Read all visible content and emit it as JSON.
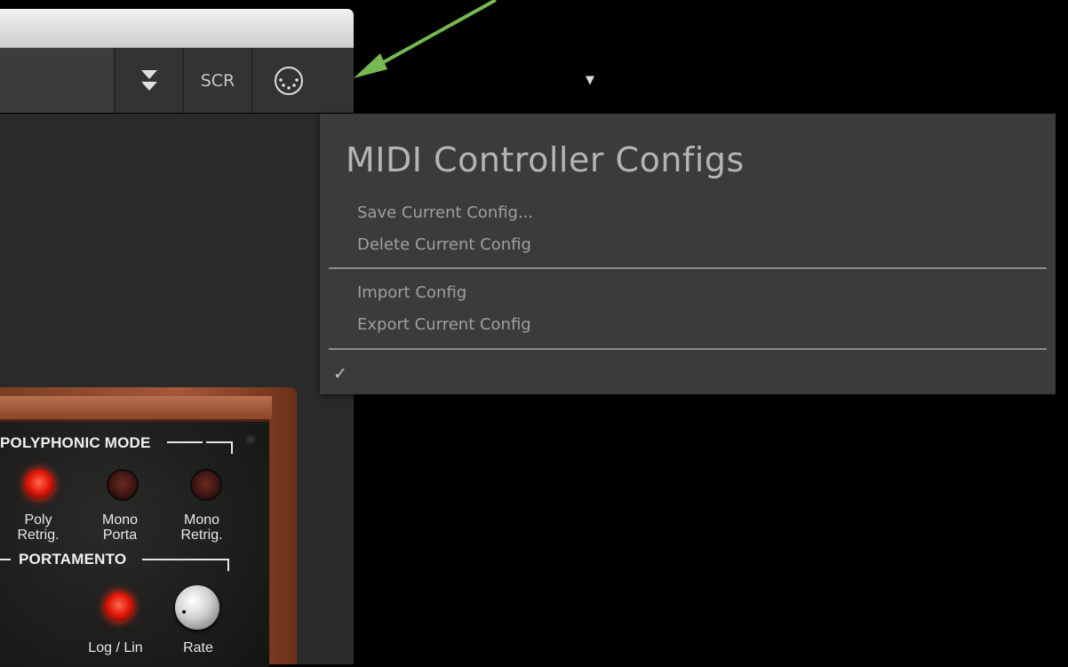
{
  "toolbar": {
    "scr_label": "SCR",
    "collapse_icon": "double-chevron-down-icon",
    "midi_icon": "midi-port-icon",
    "dropdown_icon": "triangle-down-icon",
    "dropdown_glyph": "▼"
  },
  "menu": {
    "title": "MIDI Controller Configs",
    "items_group1": [
      "Save Current Config...",
      "Delete Current Config"
    ],
    "items_group2": [
      "Import Config",
      "Export Current Config"
    ],
    "checked_glyph": "✓"
  },
  "synth": {
    "polyphonic_title": "POLYPHONIC MODE",
    "portamento_title": "PORTAMENTO",
    "buttons": [
      {
        "line1": "Poly",
        "line2": "Retrig.",
        "state": "on"
      },
      {
        "line1": "Mono",
        "line2": "Porta",
        "state": "off"
      },
      {
        "line1": "Mono",
        "line2": "Retrig.",
        "state": "off"
      }
    ],
    "loglin_label": "Log / Lin",
    "loglin_state": "on",
    "rate_label": "Rate"
  },
  "colors": {
    "annotation_arrow": "#76b852",
    "menu_bg": "#3b3b3b",
    "led_on": "#e21b0b"
  }
}
